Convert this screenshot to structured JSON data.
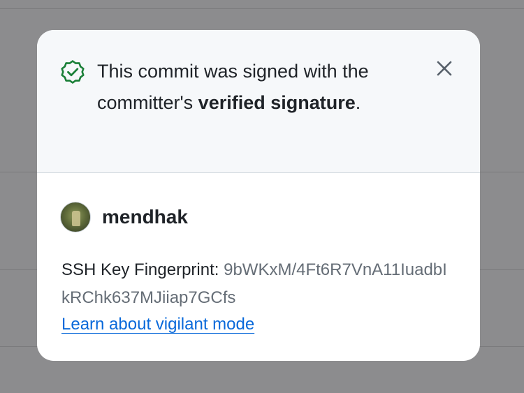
{
  "popover": {
    "message_prefix": "This commit was signed with the committer's ",
    "message_bold": "verified signature",
    "message_suffix": ".",
    "close_label": "Close"
  },
  "signer": {
    "username": "mendhak"
  },
  "ssh_key": {
    "label": "SSH Key Fingerprint: ",
    "fingerprint": "9bWKxM/4Ft6R7VnA11IuadbIkRChk637MJiiap7GCfs"
  },
  "link": {
    "text": "Learn about vigilant mode"
  },
  "icons": {
    "verified": "verified-check-icon",
    "close": "close-icon"
  },
  "colors": {
    "verified_green": "#1a7f37",
    "link_blue": "#0969da",
    "muted_text": "#656d76",
    "header_bg": "#f6f8fa",
    "overlay": "#8c8c8e"
  }
}
